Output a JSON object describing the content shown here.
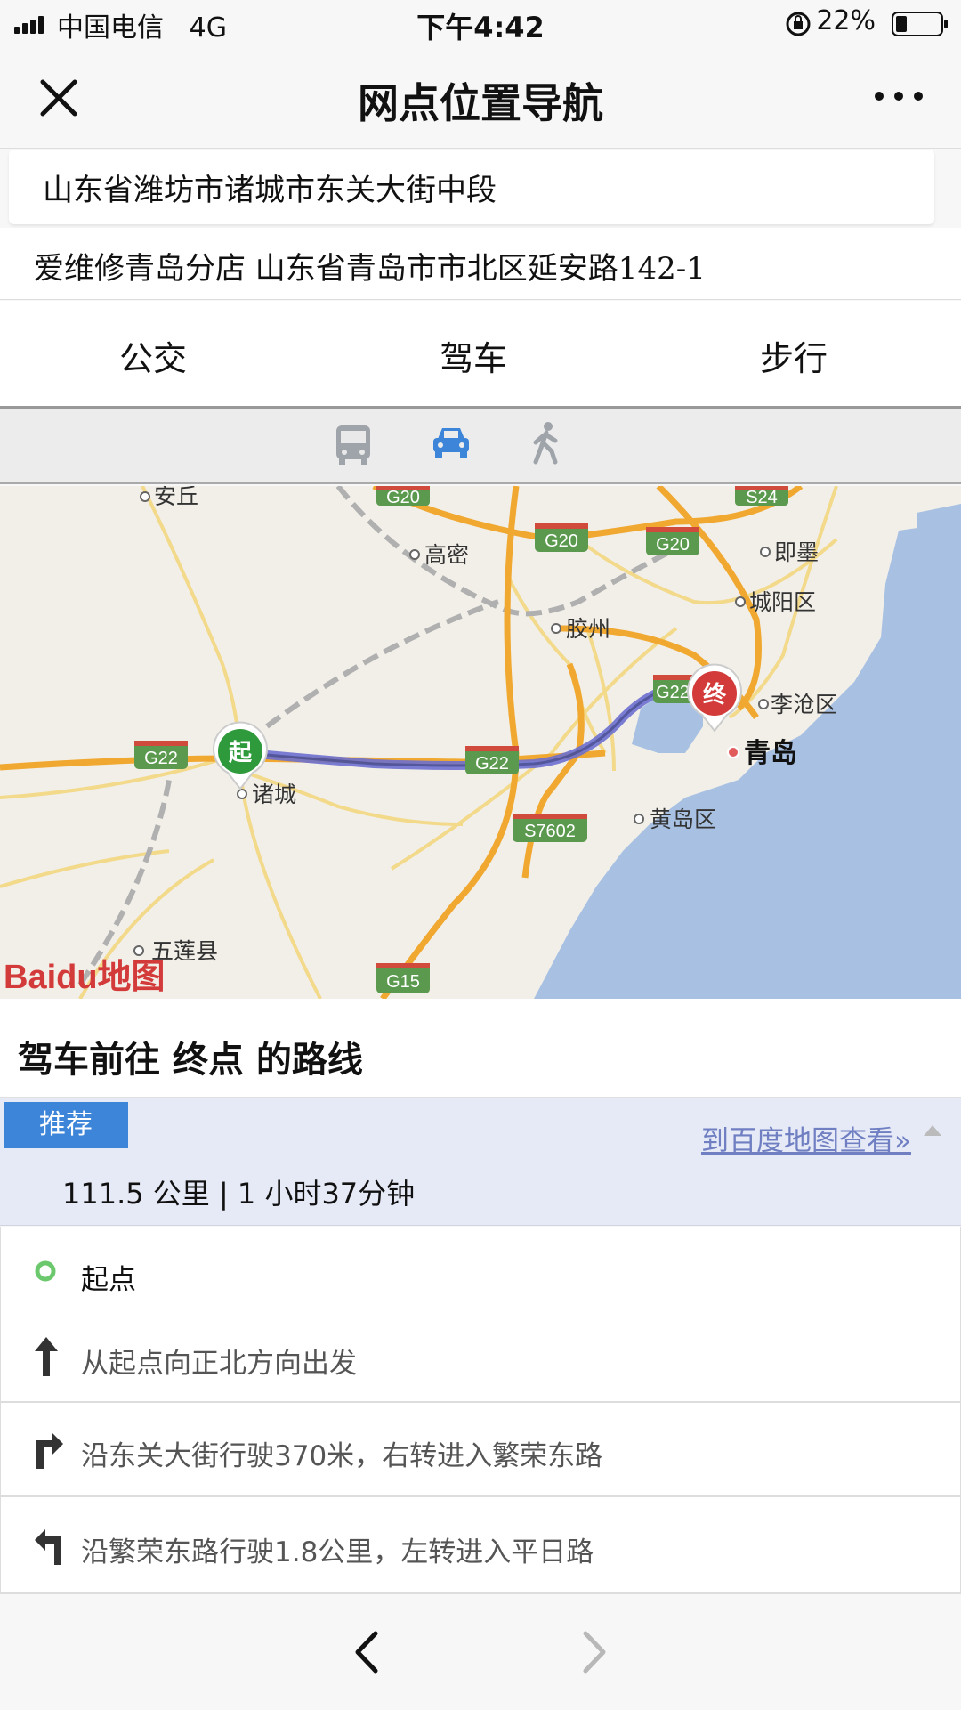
{
  "status_bar": {
    "carrier": "中国电信",
    "network": "4G",
    "time": "下午4:42",
    "battery": "22%"
  },
  "header": {
    "title": "网点位置导航",
    "close_icon": "close-icon",
    "more_icon": "more-icon"
  },
  "addresses": {
    "origin": "山东省潍坊市诸城市东关大街中段",
    "destination": "爱维修青岛分店 山东省青岛市市北区延安路142-1"
  },
  "tabs": [
    "公交",
    "驾车",
    "步行"
  ],
  "mode_icons": [
    "bus-icon",
    "car-icon",
    "walk-icon"
  ],
  "map": {
    "places": [
      "安丘",
      "高密",
      "即墨",
      "城阳区",
      "胶州",
      "李沧区",
      "青岛",
      "诸城",
      "黄岛区",
      "五莲县"
    ],
    "highways": [
      "G20",
      "G20",
      "G20",
      "S24",
      "G22",
      "G22",
      "G22",
      "S7602",
      "G15"
    ],
    "start_marker": "起",
    "end_marker": "终",
    "logo": "Baidu地图"
  },
  "route": {
    "heading": "驾车前往 终点 的路线",
    "tag": "推荐",
    "view_link": "到百度地图查看»",
    "distance_time": "111.5 公里  |  1 小时37分钟",
    "steps": [
      {
        "icon": "start-circle-icon",
        "text": "起点"
      },
      {
        "icon": "arrow-up-icon",
        "text": "从起点向正北方向出发"
      },
      {
        "icon": "turn-right-icon",
        "text": "沿东关大街行驶370米，右转进入繁荣东路"
      },
      {
        "icon": "turn-left-icon",
        "text": "沿繁荣东路行驶1.8公里，左转进入平日路"
      }
    ]
  },
  "colors": {
    "accent": "#3d85d8",
    "route": "#6b6fcf",
    "sea": "#a8c1e3",
    "highway": "#f0a830"
  }
}
